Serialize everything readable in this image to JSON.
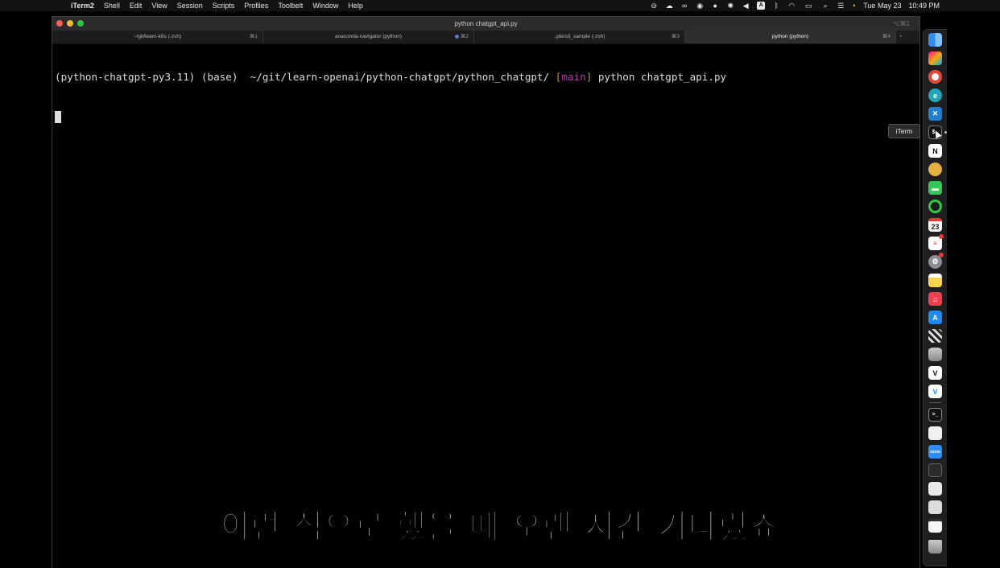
{
  "menubar": {
    "app": "iTerm2",
    "items": [
      "Shell",
      "Edit",
      "View",
      "Session",
      "Scripts",
      "Profiles",
      "Toolbelt",
      "Window",
      "Help"
    ],
    "input_source": "A",
    "date": "Tue May 23",
    "time": "10:49 PM"
  },
  "window": {
    "title": "python chatgpt_api.py",
    "title_shortcut": "⌥⌘1",
    "tabs": [
      {
        "label": "~/git/learn-k8s (-zsh)",
        "shortcut": "⌘1"
      },
      {
        "label": "anaconda-navigator (python)",
        "shortcut": "⌘2"
      },
      {
        "label": "..ple/s3_sample (-zsh)",
        "shortcut": "⌘3"
      },
      {
        "label": "python (python)",
        "shortcut": "⌘4"
      }
    ],
    "add_tab": "+"
  },
  "terminal": {
    "env": "(python-chatgpt-py3.11) (base)",
    "apple": "",
    "path": "~/git/learn-openai/python-chatgpt/python_chatgpt/",
    "branch_open": "[",
    "branch": "main",
    "branch_close": "]",
    "command": "python chatgpt_api.py"
  },
  "dock": {
    "tooltip": "iTerm",
    "calendar_day": "23",
    "notion_letter": "N",
    "zoom_label": "zoom"
  },
  "subtitle": "이런 식으로 했을 때 오랜 시간 기다렸죠",
  "colors": {
    "terminal_bg": "#000000",
    "prompt_apple": "#c84bd6",
    "branch": "#b53aa8",
    "branch_bracket": "#b09a2a"
  }
}
